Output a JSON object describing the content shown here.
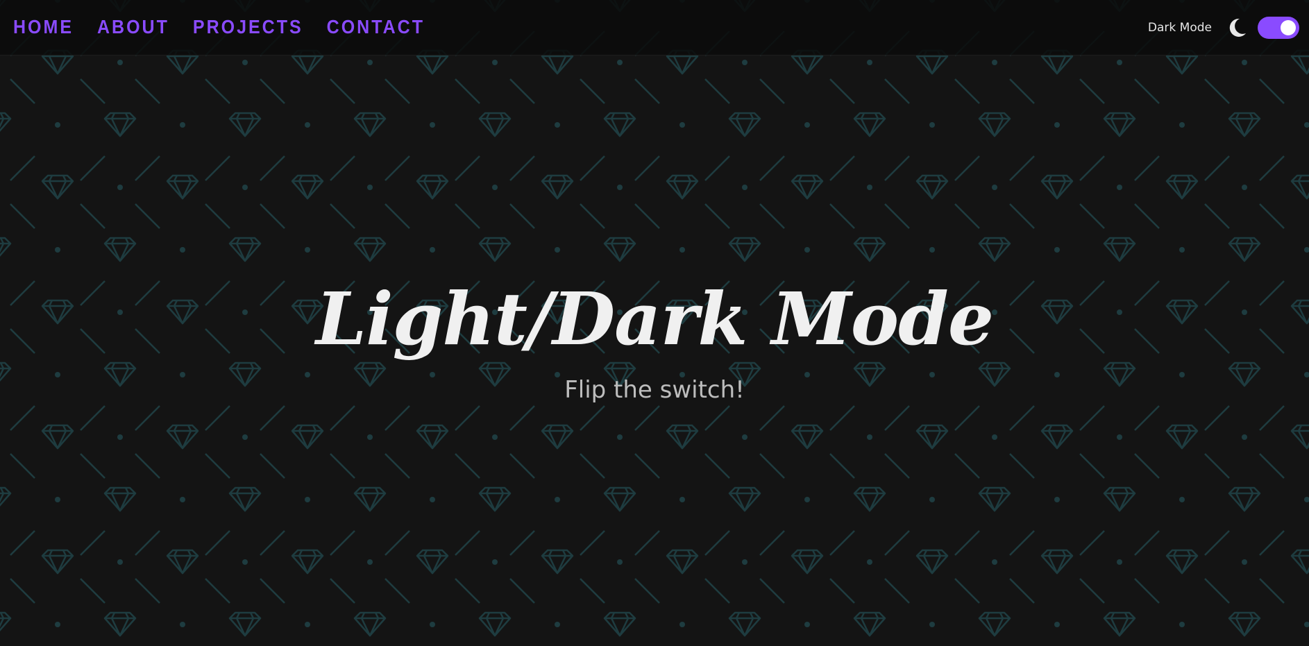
{
  "nav": {
    "items": [
      {
        "label": "HOME"
      },
      {
        "label": "ABOUT"
      },
      {
        "label": "PROJECTS"
      },
      {
        "label": "CONTACT"
      }
    ]
  },
  "mode_toggle": {
    "label": "Dark Mode",
    "icon": "moon-icon",
    "enabled": true,
    "accent_color": "#8a4bff"
  },
  "hero": {
    "title": "Light/Dark Mode",
    "subtitle": "Flip the switch!"
  },
  "theme": {
    "background": "#141414",
    "pattern_color": "#1e3c40",
    "pattern_icon": "diamond-icon"
  }
}
